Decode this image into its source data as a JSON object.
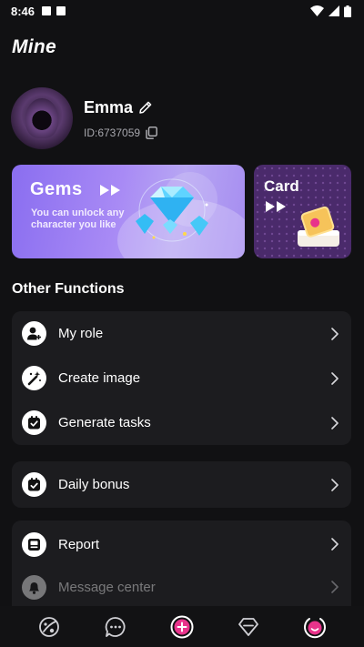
{
  "status_bar": {
    "time": "8:46"
  },
  "page": {
    "title": "Mine"
  },
  "profile": {
    "username": "Emma",
    "user_id": "ID:6737059"
  },
  "banners": {
    "gems": {
      "title": "Gems",
      "subtitle": "You can unlock any character you like"
    },
    "card": {
      "title": "Card"
    }
  },
  "other_functions": {
    "title": "Other Functions",
    "groups": [
      {
        "items": [
          {
            "label": "My role",
            "icon": "user-add-icon"
          },
          {
            "label": "Create image",
            "icon": "magic-wand-icon"
          },
          {
            "label": "Generate tasks",
            "icon": "task-check-icon"
          }
        ]
      },
      {
        "items": [
          {
            "label": "Daily bonus",
            "icon": "calendar-check-icon"
          }
        ]
      },
      {
        "items": [
          {
            "label": "Report",
            "icon": "inbox-icon"
          },
          {
            "label": "Message center",
            "icon": "bell-icon"
          }
        ]
      }
    ]
  },
  "bottom_nav": {
    "items": [
      {
        "icon": "planet-icon"
      },
      {
        "icon": "chat-bubble-icon"
      },
      {
        "icon": "plus-circle-icon"
      },
      {
        "icon": "diamond-icon"
      },
      {
        "icon": "profile-face-icon",
        "active": true
      }
    ]
  },
  "colors": {
    "background": "#111113",
    "card": "#1c1c1f",
    "gems_banner": "#a88af5",
    "card_banner": "#4a2a6b",
    "accent_pink": "#e8338b"
  }
}
